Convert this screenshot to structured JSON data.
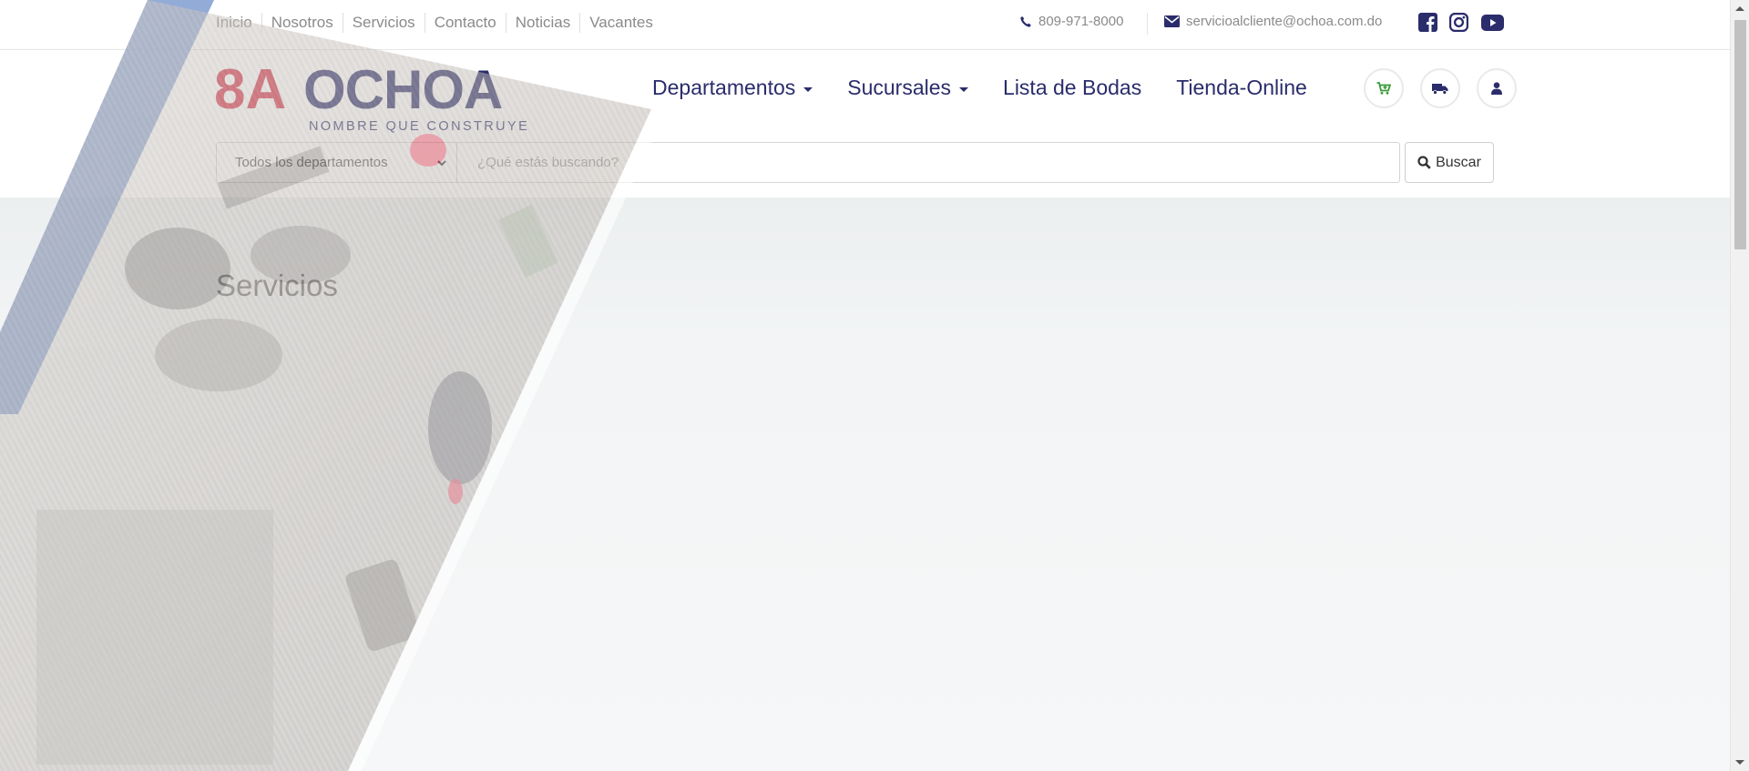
{
  "topbar": {
    "links": [
      "Inicio",
      "Nosotros",
      "Servicios",
      "Contacto",
      "Noticias",
      "Vacantes"
    ],
    "phone": "809-971-8000",
    "email": "servicioalcliente@ochoa.com.do",
    "social_icons": [
      "facebook-icon",
      "instagram-icon",
      "youtube-icon"
    ]
  },
  "logo": {
    "mark": "8A",
    "name": "OCHOA",
    "tagline": "NOMBRE QUE CONSTRUYE"
  },
  "nav": {
    "items": [
      {
        "label": "Departamentos",
        "dropdown": true
      },
      {
        "label": "Sucursales",
        "dropdown": true
      },
      {
        "label": "Lista de Bodas",
        "dropdown": false
      },
      {
        "label": "Tienda-Online",
        "dropdown": false
      }
    ],
    "icon_buttons": [
      "cart-icon",
      "truck-icon",
      "user-icon"
    ]
  },
  "search": {
    "department_selected": "Todos los departamentos",
    "placeholder": "¿Qué estás buscando?",
    "button_label": "Buscar"
  },
  "page": {
    "title": "Servicios"
  },
  "colors": {
    "brand_navy": "#2a2c6b",
    "brand_red": "#d8344a",
    "cart_green": "#3a9a3a"
  }
}
